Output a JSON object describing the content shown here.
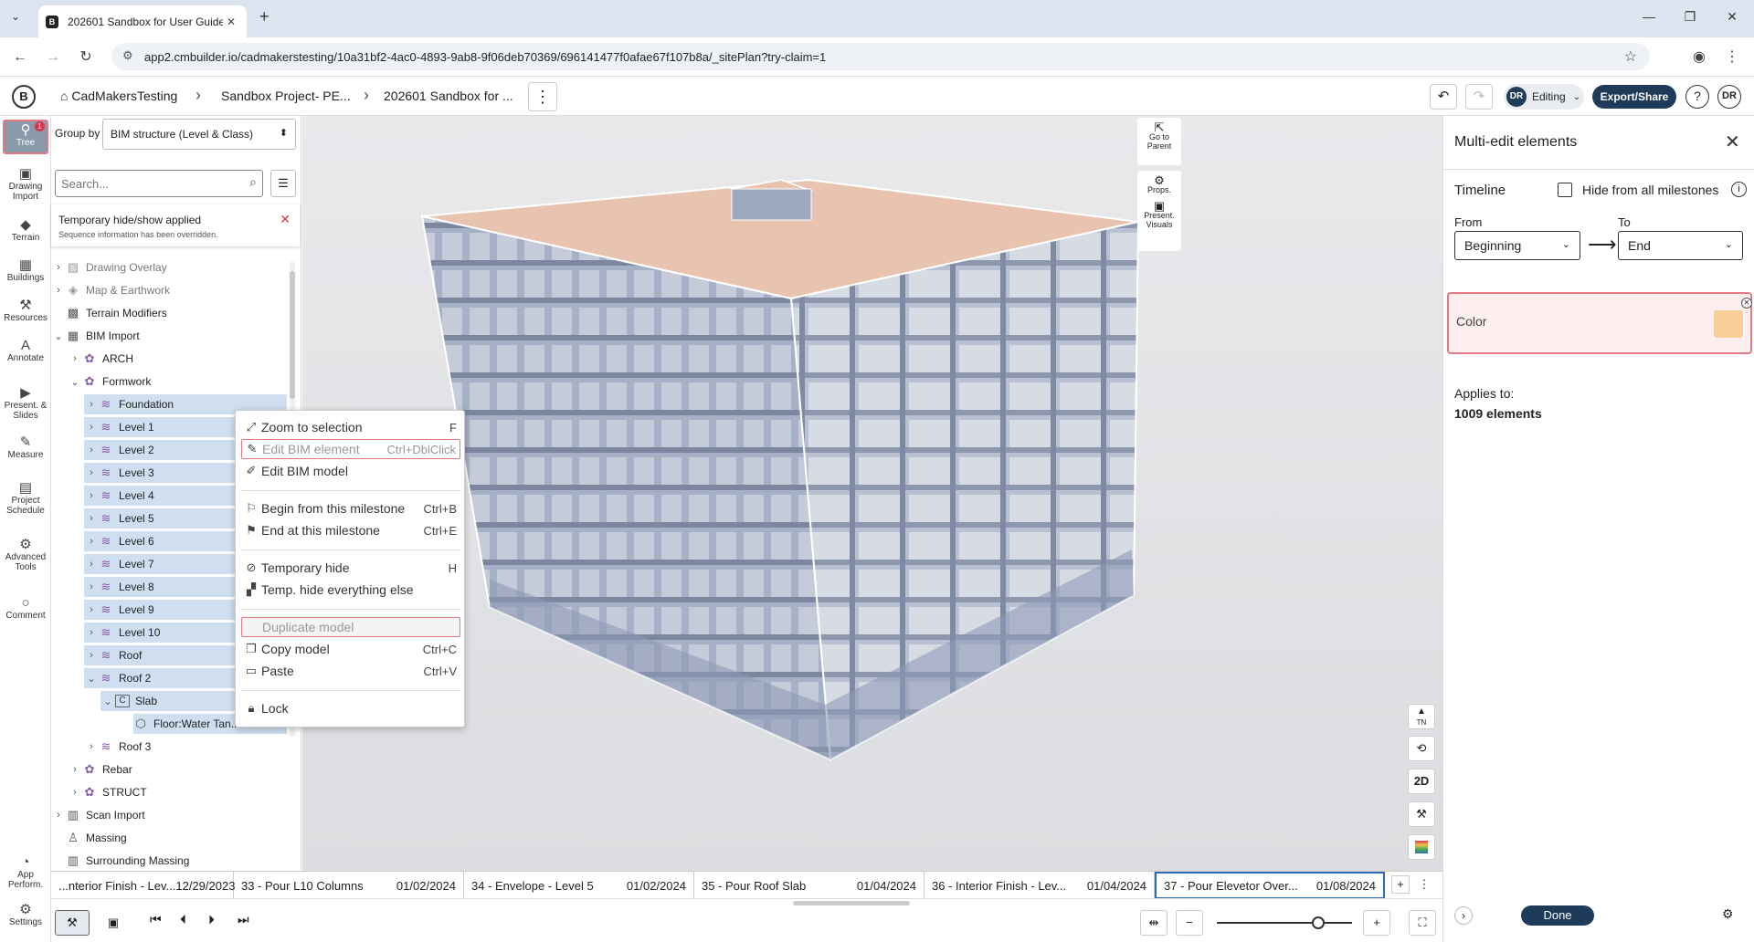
{
  "browser": {
    "tab_title": "202601 Sandbox for User Guide",
    "favicon": "B",
    "url": "app2.cmbuilder.io/cadmakerstesting/10a31bf2-4ac0-4893-9ab8-9f06deb70369/696141477f0afae67f107b8a/_sitePlan?try-claim=1"
  },
  "header": {
    "home": "CadMakersTesting",
    "project": "Sandbox Project- PE...",
    "scene": "202601 Sandbox for ...",
    "user_initials": "DR",
    "mode": "Editing",
    "export": "Export/Share",
    "help": "?",
    "avatar": "DR"
  },
  "rail": {
    "items": [
      {
        "label": "Tree",
        "icon": "tree-icon",
        "badge": "1"
      },
      {
        "label": "Drawing Import",
        "icon": "drawing-icon"
      },
      {
        "label": "Terrain",
        "icon": "terrain-icon"
      },
      {
        "label": "Buildings",
        "icon": "buildings-icon"
      },
      {
        "label": "Resources",
        "icon": "resources-icon"
      },
      {
        "label": "Annotate",
        "icon": "annotate-icon"
      },
      {
        "label": "Present. & Slides",
        "icon": "present-icon"
      },
      {
        "label": "Measure",
        "icon": "measure-icon"
      },
      {
        "label": "Project Schedule",
        "icon": "schedule-icon"
      },
      {
        "label": "Advanced Tools",
        "icon": "advanced-icon"
      },
      {
        "label": "Comment",
        "icon": "comment-icon"
      },
      {
        "label": "App Perform.",
        "icon": "performance-icon"
      },
      {
        "label": "Settings",
        "icon": "settings-icon"
      }
    ]
  },
  "tree": {
    "group_by_label": "Group by",
    "group_by_value": "BIM structure (Level & Class)",
    "search_placeholder": "Search...",
    "notice_title": "Temporary hide/show applied",
    "notice_sub": "Sequence information has been overridden.",
    "rows": [
      {
        "label": "Drawing Overlay"
      },
      {
        "label": "Map & Earthwork"
      },
      {
        "label": "Terrain Modifiers"
      },
      {
        "label": "BIM Import"
      },
      {
        "label": "ARCH"
      },
      {
        "label": "Formwork"
      },
      {
        "label": "Foundation"
      },
      {
        "label": "Level 1"
      },
      {
        "label": "Level 2"
      },
      {
        "label": "Level 3"
      },
      {
        "label": "Level 4"
      },
      {
        "label": "Level 5"
      },
      {
        "label": "Level 6"
      },
      {
        "label": "Level 7"
      },
      {
        "label": "Level 8"
      },
      {
        "label": "Level 9"
      },
      {
        "label": "Level 10"
      },
      {
        "label": "Roof"
      },
      {
        "label": "Roof 2"
      },
      {
        "label": "Slab"
      },
      {
        "label": "Floor:Water Tan..."
      },
      {
        "label": "Roof 3"
      },
      {
        "label": "Rebar"
      },
      {
        "label": "STRUCT"
      },
      {
        "label": "Scan Import"
      },
      {
        "label": "Massing"
      },
      {
        "label": "Surrounding Massing"
      }
    ]
  },
  "context_menu": {
    "items": [
      {
        "label": "Zoom to selection",
        "shortcut": "F"
      },
      {
        "label": "Edit BIM element",
        "shortcut": "Ctrl+DblClick"
      },
      {
        "label": "Edit BIM model",
        "shortcut": ""
      },
      {
        "label": "Begin from this milestone",
        "shortcut": "Ctrl+B"
      },
      {
        "label": "End at this milestone",
        "shortcut": "Ctrl+E"
      },
      {
        "label": "Temporary hide",
        "shortcut": "H"
      },
      {
        "label": "Temp. hide everything else",
        "shortcut": ""
      },
      {
        "label": "Duplicate model",
        "shortcut": ""
      },
      {
        "label": "Copy model",
        "shortcut": "Ctrl+C"
      },
      {
        "label": "Paste",
        "shortcut": "Ctrl+V"
      },
      {
        "label": "Lock",
        "shortcut": ""
      }
    ]
  },
  "view_tools": {
    "go_parent": "Go to Parent",
    "props": "Props.",
    "present": "Present. Visuals",
    "north": "TN",
    "twod": "2D"
  },
  "right_panel": {
    "title": "Multi-edit elements",
    "timeline_label": "Timeline",
    "hide_label": "Hide from all milestones",
    "from_label": "From",
    "to_label": "To",
    "from_value": "Beginning",
    "to_value": "End",
    "color_label": "Color",
    "color_value": "#f9cf98",
    "applies_label": "Applies to:",
    "applies_value": "1009 elements",
    "done": "Done"
  },
  "milestones": [
    {
      "name": "...nterior Finish - Lev...",
      "date": "12/29/2023"
    },
    {
      "name": "33 - Pour L10 Columns",
      "date": "01/02/2024"
    },
    {
      "name": "34 - Envelope - Level 5",
      "date": "01/02/2024"
    },
    {
      "name": "35 - Pour Roof Slab",
      "date": "01/04/2024"
    },
    {
      "name": "36 - Interior Finish - Lev...",
      "date": "01/04/2024"
    },
    {
      "name": "37 - Pour Elevetor Over...",
      "date": "01/08/2024"
    }
  ],
  "colors": {
    "accent": "#1f4e79",
    "selection": "#cfdff0",
    "highlight_red": "#e27a86",
    "roof": "#e8c4b0"
  }
}
